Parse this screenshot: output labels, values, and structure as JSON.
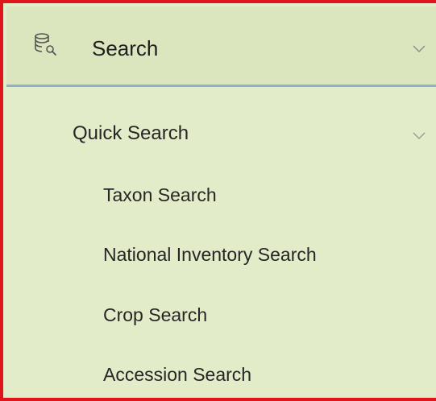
{
  "header": {
    "icon": "database-search-icon",
    "title": "Search",
    "chevron_icon": "chevron-down-icon"
  },
  "menu": {
    "quick_search": {
      "label": "Quick Search",
      "chevron_icon": "chevron-down-icon"
    },
    "items": [
      {
        "label": "Taxon Search"
      },
      {
        "label": "National Inventory Search"
      },
      {
        "label": "Crop Search"
      },
      {
        "label": "Accession Search"
      }
    ]
  },
  "colors": {
    "border": "#e0151b",
    "background": "#e3ecc9",
    "header_background": "#dbe6bf",
    "divider": "#8fb2cc",
    "text": "#262626"
  }
}
